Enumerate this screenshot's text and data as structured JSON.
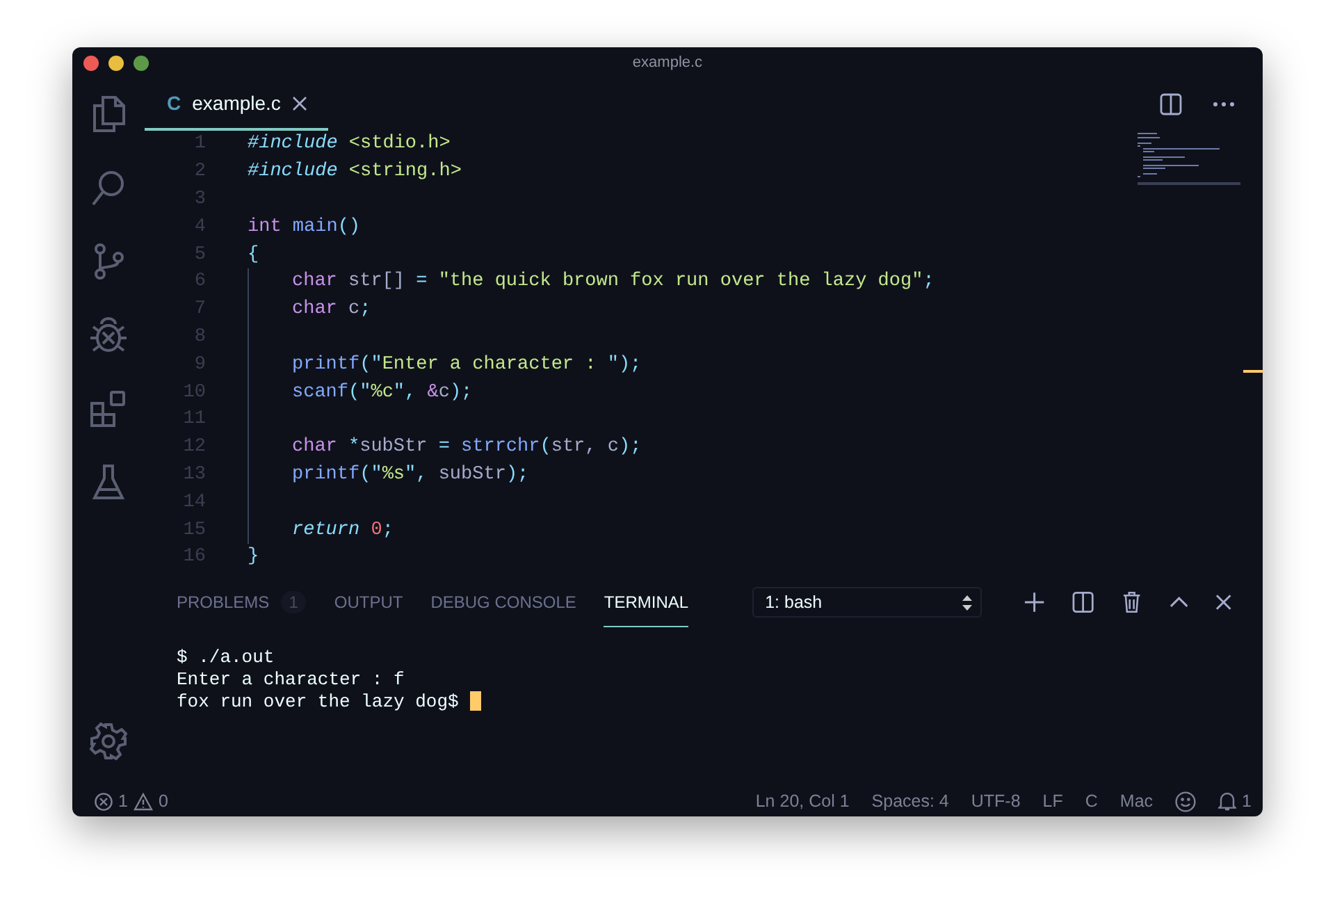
{
  "window": {
    "title": "example.c"
  },
  "tabs": [
    {
      "icon_text": "C",
      "label": "example.c",
      "selected": true
    }
  ],
  "editor": {
    "lines": [
      {
        "number": "1",
        "tokens": [
          {
            "text": "#include",
            "kind": "preproc"
          },
          {
            "text": " <stdio.h>",
            "kind": "string"
          }
        ]
      },
      {
        "number": "2",
        "tokens": [
          {
            "text": "#include",
            "kind": "preproc"
          },
          {
            "text": " <string.h>",
            "kind": "string"
          }
        ]
      },
      {
        "number": "3"
      },
      {
        "number": "4",
        "tokens": [
          {
            "text": "int",
            "kind": "keyword"
          },
          {
            "text": " main",
            "kind": "function"
          },
          {
            "text": "()",
            "kind": "punct"
          }
        ]
      },
      {
        "number": "5",
        "tokens": [
          {
            "text": "{",
            "kind": "punct"
          }
        ],
        "children": [
          {
            "number": "6",
            "tokens": [
              {
                "text": "char",
                "kind": "keyword"
              },
              {
                "text": " str[] ",
                "kind": "plain"
              },
              {
                "text": "= ",
                "kind": "punct"
              },
              {
                "text": "\"the quick brown fox run over the lazy dog\"",
                "kind": "string"
              },
              {
                "text": ";",
                "kind": "punct"
              }
            ]
          },
          {
            "number": "7",
            "tokens": [
              {
                "text": "char",
                "kind": "keyword"
              },
              {
                "text": " c",
                "kind": "plain"
              },
              {
                "text": ";",
                "kind": "punct"
              }
            ]
          },
          {
            "number": "8"
          },
          {
            "number": "9",
            "tokens": [
              {
                "text": "printf",
                "kind": "function"
              },
              {
                "text": "(\"",
                "kind": "punct"
              },
              {
                "text": "Enter a character : ",
                "kind": "string"
              },
              {
                "text": "\");",
                "kind": "punct"
              }
            ]
          },
          {
            "number": "10",
            "tokens": [
              {
                "text": "scanf",
                "kind": "function"
              },
              {
                "text": "(\"",
                "kind": "punct"
              },
              {
                "text": "%c",
                "kind": "string"
              },
              {
                "text": "\", ",
                "kind": "punct"
              },
              {
                "text": "&",
                "kind": "keyword"
              },
              {
                "text": "c",
                "kind": "plain"
              },
              {
                "text": ");",
                "kind": "punct"
              }
            ]
          },
          {
            "number": "11"
          },
          {
            "number": "12",
            "tokens": [
              {
                "text": "char",
                "kind": "keyword"
              },
              {
                "text": " *",
                "kind": "punct"
              },
              {
                "text": "subStr ",
                "kind": "plain"
              },
              {
                "text": "= ",
                "kind": "punct"
              },
              {
                "text": "strrchr",
                "kind": "function"
              },
              {
                "text": "(",
                "kind": "punct"
              },
              {
                "text": "str, c",
                "kind": "plain"
              },
              {
                "text": ");",
                "kind": "punct"
              }
            ]
          },
          {
            "number": "13",
            "tokens": [
              {
                "text": "printf",
                "kind": "function"
              },
              {
                "text": "(\"",
                "kind": "punct"
              },
              {
                "text": "%s",
                "kind": "string"
              },
              {
                "text": "\", ",
                "kind": "punct"
              },
              {
                "text": "subStr",
                "kind": "plain"
              },
              {
                "text": ");",
                "kind": "punct"
              }
            ]
          },
          {
            "number": "14"
          },
          {
            "number": "15",
            "tokens": [
              {
                "text": "return",
                "kind": "control"
              },
              {
                "text": " 0",
                "kind": "number"
              },
              {
                "text": ";",
                "kind": "punct"
              }
            ]
          }
        ]
      },
      {
        "number": "16",
        "tokens": [
          {
            "text": "}",
            "kind": "punct"
          }
        ]
      }
    ]
  },
  "panel": {
    "tabs": [
      {
        "label": "PROBLEMS",
        "badge": "1",
        "selected": false
      },
      {
        "label": "OUTPUT",
        "selected": false
      },
      {
        "label": "DEBUG CONSOLE",
        "selected": false
      },
      {
        "label": "TERMINAL",
        "selected": true
      }
    ],
    "terminal_select": "1: bash",
    "terminal_lines": [
      "$ ./a.out",
      "Enter a character : f",
      "fox run over the lazy dog$ "
    ]
  },
  "status_bar": {
    "errors": "1",
    "warnings": "0",
    "right": [
      "Ln 20, Col 1",
      "Spaces: 4",
      "UTF-8",
      "LF",
      "C",
      "Mac"
    ],
    "notifications": "1"
  }
}
